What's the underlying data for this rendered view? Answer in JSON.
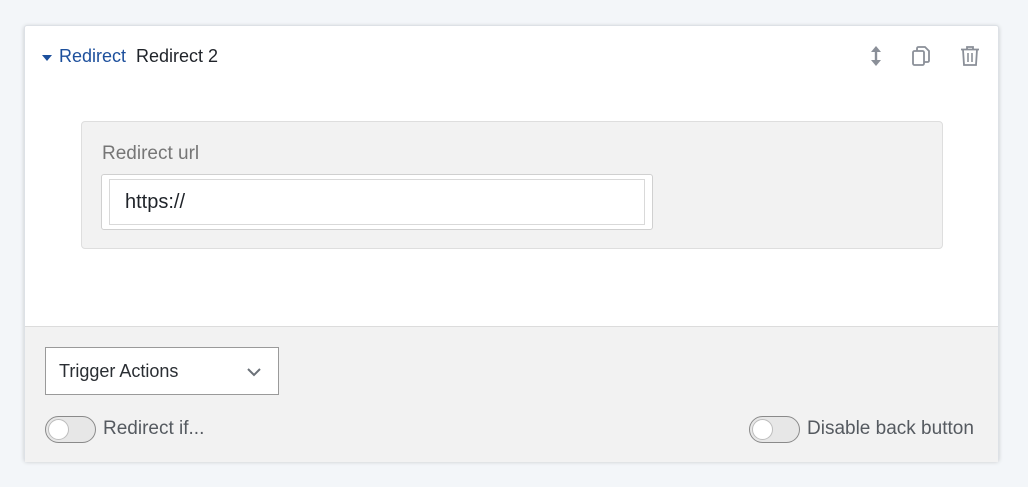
{
  "block": {
    "type_label": "Redirect",
    "name": "Redirect 2",
    "icons": {
      "move": "vertical-resize-icon",
      "copy": "copy-icon",
      "delete": "trash-icon"
    }
  },
  "field": {
    "label": "Redirect url",
    "value": "https://"
  },
  "footer": {
    "trigger_select": {
      "selected": "Trigger Actions"
    },
    "redirect_if": {
      "label": "Redirect if...",
      "enabled": false
    },
    "disable_back": {
      "label": "Disable back button",
      "enabled": false
    }
  },
  "colors": {
    "accent": "#1c4f9c",
    "icon": "#8a8f98",
    "panel_bg": "#f2f2f2"
  }
}
